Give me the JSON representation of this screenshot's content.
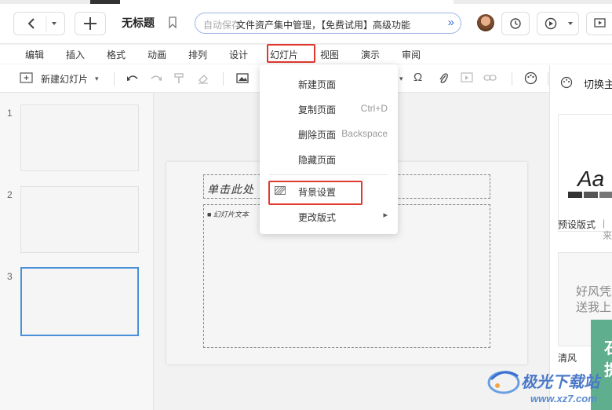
{
  "topbar": {
    "back_icon": "chevron-left-icon",
    "history_menu_icon": "caret-down-icon",
    "new_icon": "plus-icon",
    "doc_title": "无标题",
    "bookmark_icon": "bookmark-icon",
    "autosave_ghost": "自动保存",
    "banner_text": "文件资产集中管理，【免费试用】高级功能",
    "banner_arrow": "»",
    "history_icon": "history-icon",
    "play_icon": "play-icon",
    "play_menu_icon": "caret-down-icon",
    "present_icon": "present-icon"
  },
  "menubar": {
    "items": [
      "编辑",
      "插入",
      "格式",
      "动画",
      "排列",
      "设计",
      "幻灯片",
      "视图",
      "演示",
      "审阅"
    ],
    "active": "幻灯片"
  },
  "toolbar": {
    "new_slide_label": "新建幻灯片",
    "new_slide_caret": "▾",
    "omega": "Ω",
    "theme_label": "切换主"
  },
  "slides": {
    "numbers": [
      "1",
      "2",
      "3"
    ],
    "selected": "3"
  },
  "canvas": {
    "title_placeholder": "单击此处",
    "body_placeholder": "■  幻灯片文本"
  },
  "dropdown": {
    "items": [
      {
        "label": "新建页面",
        "shortcut": ""
      },
      {
        "label": "复制页面",
        "shortcut": "Ctrl+D"
      },
      {
        "label": "删除页面",
        "shortcut": "Backspace"
      },
      {
        "label": "隐藏页面",
        "shortcut": ""
      },
      {
        "label": "背景设置",
        "shortcut": ""
      },
      {
        "label": "更改版式",
        "shortcut": "▸"
      }
    ]
  },
  "rightpanel": {
    "preview1_text": "Aa",
    "preview1_label": "预设版式",
    "preview1_label2": "来",
    "preview2_line1": "好风凭",
    "preview2_line2": "送我上",
    "preview2_label": "清风",
    "green_text1": "石",
    "green_text2": "提"
  },
  "watermark": {
    "brand": "极光下载站",
    "url": "www.xz7.com"
  },
  "colors": {
    "highlight_red": "#e03a2f",
    "selected_blue": "#4a90d9",
    "banner_blue": "#3a6fd8"
  }
}
